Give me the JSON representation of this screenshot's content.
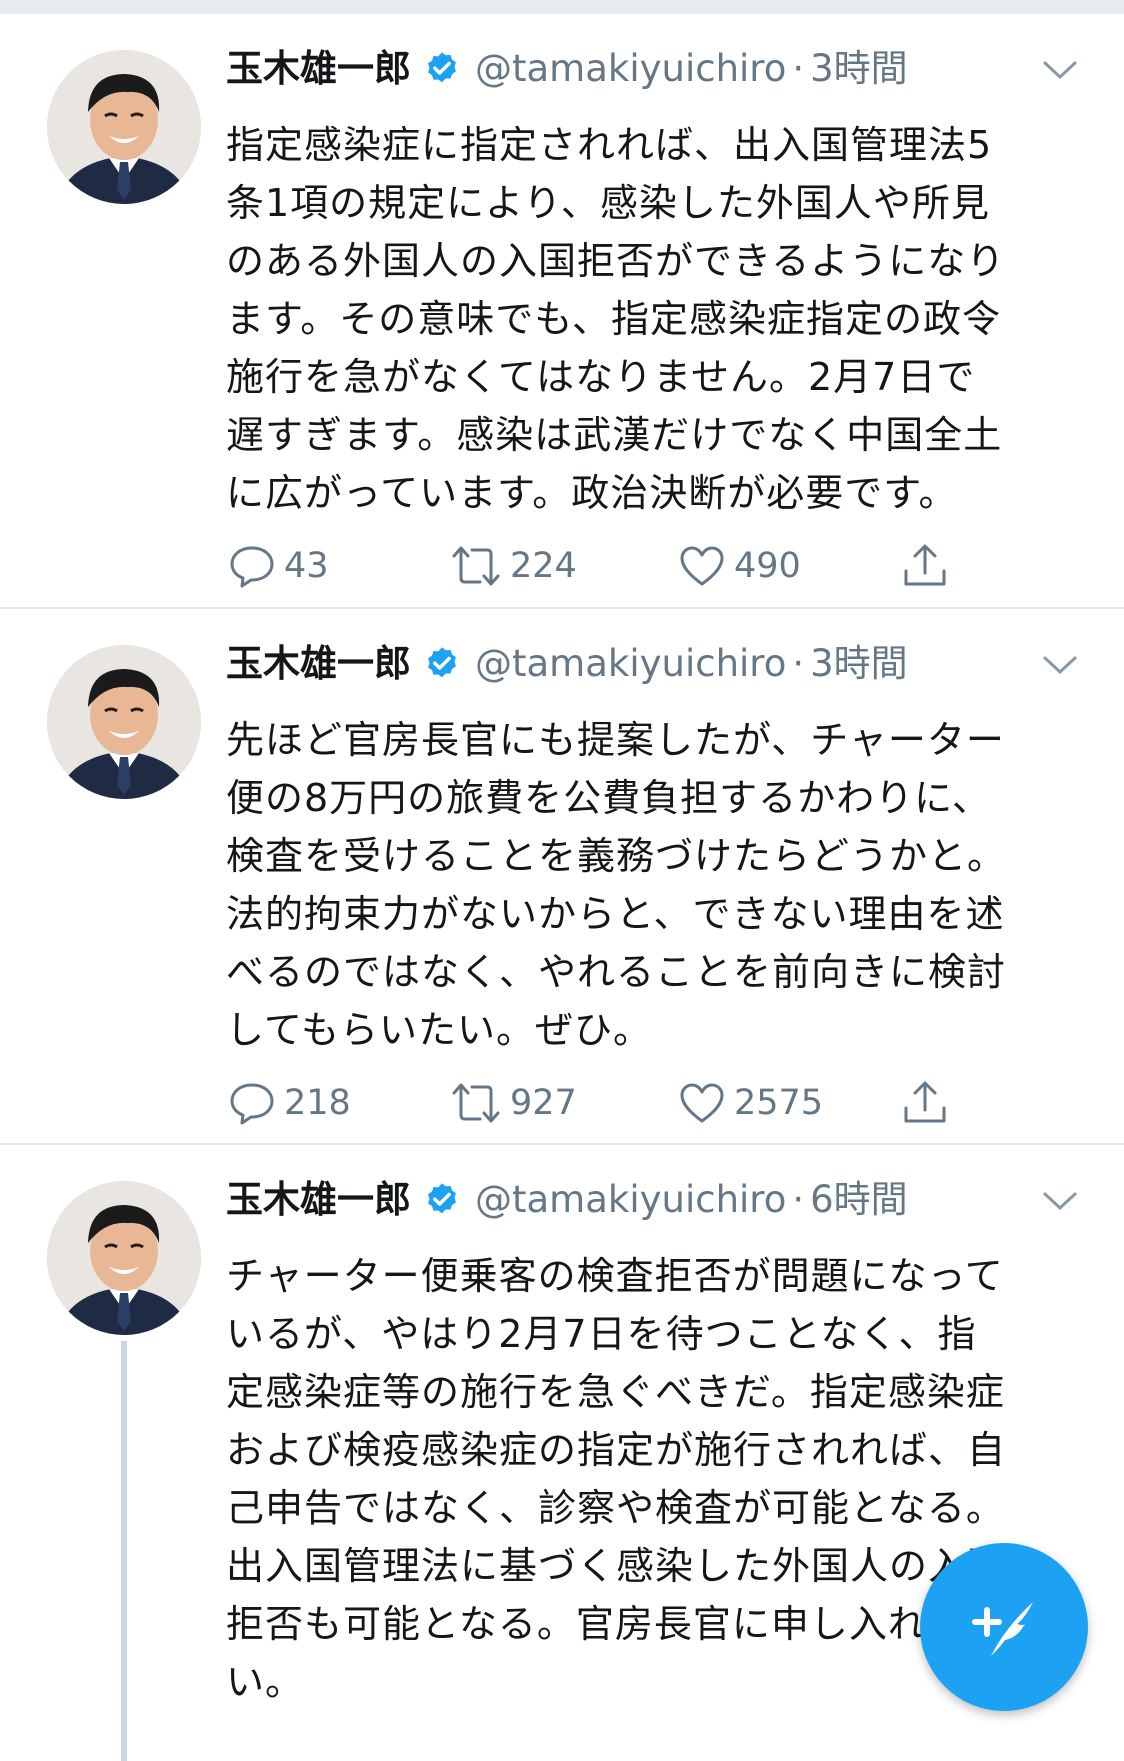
{
  "colors": {
    "accent": "#1da1f2",
    "verified": "#1da1f2",
    "secondary_text": "#657786",
    "primary_text": "#14171a",
    "divider": "#e1e8ed"
  },
  "tweets": [
    {
      "name": "玉木雄一郎",
      "handle": "@tamakiyuichiro",
      "separator": "·",
      "time": "3時間",
      "text": "指定感染症に指定されれば、出入国管理法5\n条1項の規定により、感染した外国人や所見\nのある外国人の入国拒否ができるようになり\nます。その意味でも、指定感染症指定の政令\n施行を急がなくてはなりません。2月7日で\n遅すぎます。感染は武漢だけでなく中国全土\nに広がっています。政治決断が必要です。",
      "replies": "43",
      "retweets": "224",
      "likes": "490"
    },
    {
      "name": "玉木雄一郎",
      "handle": "@tamakiyuichiro",
      "separator": "·",
      "time": "3時間",
      "text": "先ほど官房長官にも提案したが、チャーター\n便の8万円の旅費を公費負担するかわりに、\n検査を受けることを義務づけたらどうかと。\n法的拘束力がないからと、できない理由を述\nべるのではなく、やれることを前向きに検討\nしてもらいたい。ぜひ。",
      "replies": "218",
      "retweets": "927",
      "likes": "2575"
    },
    {
      "name": "玉木雄一郎",
      "handle": "@tamakiyuichiro",
      "separator": "·",
      "time": "6時間",
      "text": "チャーター便乗客の検査拒否が問題になって\nいるが、やはり2月7日を待つことなく、指\n定感染症等の施行を急ぐべきだ。指定感染症\nおよび検疫感染症の指定が施行されれば、自\n己申告ではなく、診察や検査が可能となる。\n出入国管理法に基づく感染した外国人の入国\n拒否も可能となる。官房長官に申し入れた\nい。"
    }
  ],
  "icons": {
    "verified": "verified-badge-icon",
    "caret": "chevron-down-icon",
    "reply": "reply-icon",
    "retweet": "retweet-icon",
    "like": "heart-icon",
    "share": "share-icon",
    "compose": "compose-tweet-icon"
  }
}
